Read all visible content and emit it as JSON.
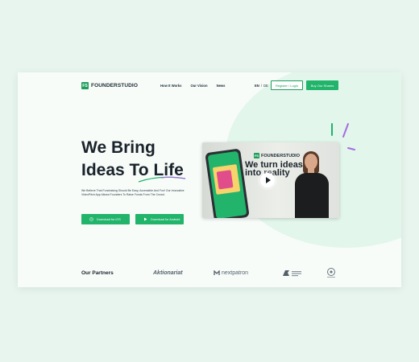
{
  "logo": {
    "mark": "FS",
    "text": "FOUNDERSTUDIO"
  },
  "nav": {
    "items": [
      "How It Works",
      "Our Vision",
      "News"
    ]
  },
  "lang": {
    "en": "EN",
    "sep": "/",
    "de": "DE"
  },
  "header": {
    "register_label": "Register / Login",
    "buy_label": "Buy Our Shares"
  },
  "hero": {
    "title_line1": "We Bring",
    "title_line2": "Ideas To Life",
    "description": "We Believe That Fundraising Should Be Easy, Accessible And Fun! Our Innovative VideoPitch App Allows Founders To Raise Funds From The Crowd.",
    "ios_label": "Download for iOS",
    "android_label": "Download for Android"
  },
  "video": {
    "logo_text": "FOUNDERSTUDIO",
    "logo_mark": "FS",
    "headline_line1": "We turn ideas",
    "headline_line2": "into reality"
  },
  "partners": {
    "title": "Our Partners",
    "names": [
      "Aktionariat",
      "nextpatron"
    ]
  },
  "colors": {
    "accent": "#21b46a",
    "dark": "#1a232b",
    "bg": "#e8f5ef"
  }
}
